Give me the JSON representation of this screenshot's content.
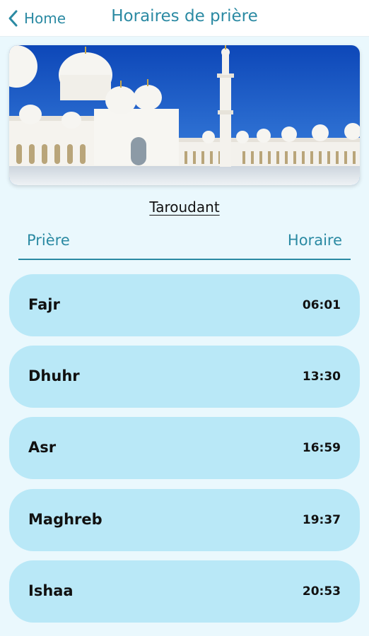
{
  "header": {
    "back_label": "Home",
    "title": "Horaires de prière"
  },
  "hero": {
    "description_icon": "mosque-photo"
  },
  "city": "Taroudant",
  "table": {
    "col_prayer": "Prière",
    "col_time": "Horaire",
    "rows": [
      {
        "name": "Fajr",
        "time": "06:01"
      },
      {
        "name": "Dhuhr",
        "time": "13:30"
      },
      {
        "name": "Asr",
        "time": "16:59"
      },
      {
        "name": "Maghreb",
        "time": "19:37"
      },
      {
        "name": "Ishaa",
        "time": "20:53"
      }
    ]
  },
  "colors": {
    "accent": "#2b8aa3",
    "row_bg": "#b9e8f7",
    "page_bg": "#eaf8fd"
  }
}
